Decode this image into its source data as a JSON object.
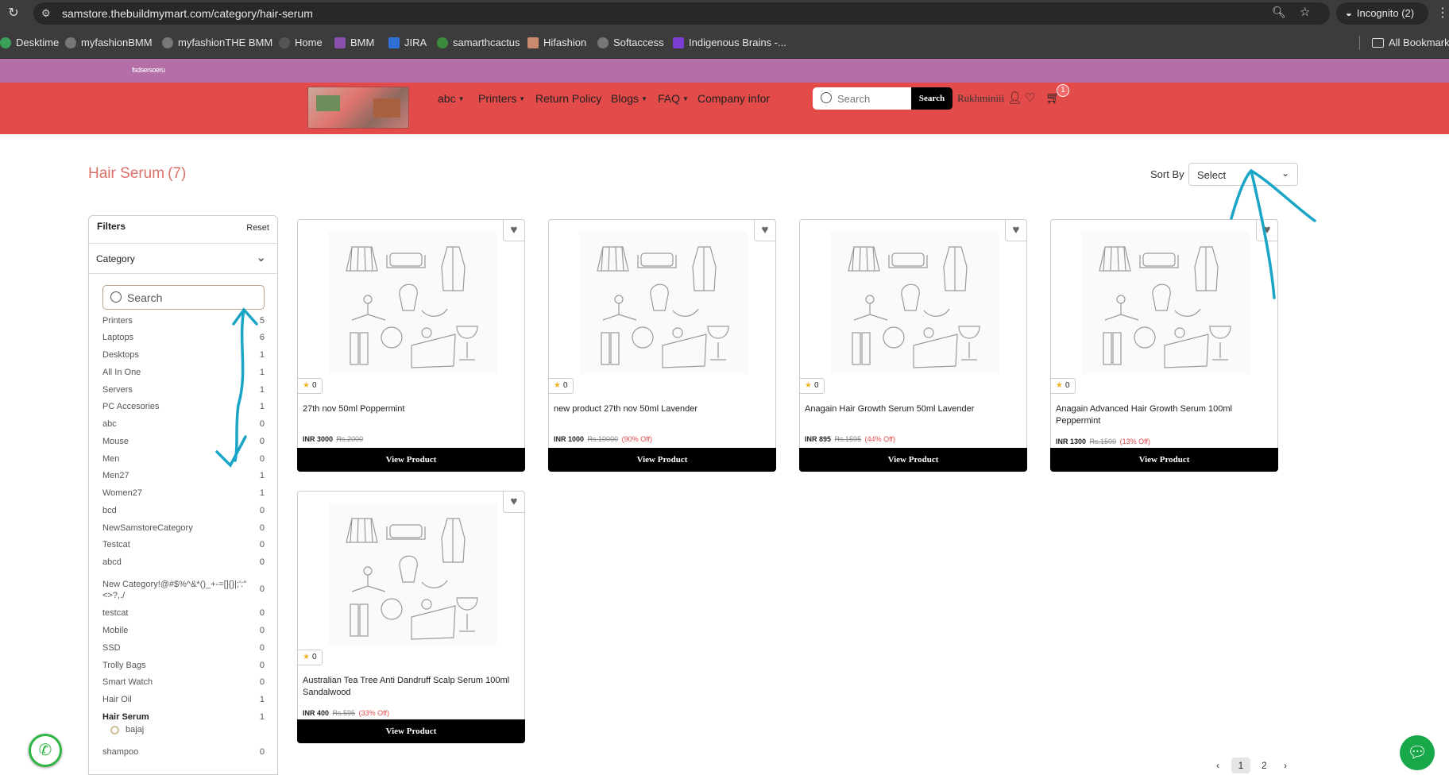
{
  "browser": {
    "url": "samstore.thebuildmymart.com/category/hair-serum",
    "incognito_label": "Incognito (2)",
    "bookmarks": [
      "Desktime",
      "myfashionBMM",
      "myfashionTHE BMM",
      "Home",
      "BMM",
      "JIRA",
      "samarthcactus",
      "Hifashion",
      "Softaccess",
      "Indigenous Brains -...",
      "All Bookmarks"
    ]
  },
  "announcement": {
    "text": "fsdsersoeru"
  },
  "header": {
    "nav": [
      "abc",
      "Printers",
      "Return Policy",
      "Blogs",
      "FAQ",
      "Company infor"
    ],
    "nav_has_caret": [
      true,
      true,
      false,
      true,
      true,
      false
    ],
    "search_placeholder": "Search",
    "search_button": "Search",
    "user_name": "Rukhminiii",
    "cart_count": "1"
  },
  "page": {
    "title": "Hair Serum",
    "count": "(7)",
    "sort_label": "Sort By",
    "sort_value": "Select"
  },
  "filters": {
    "title": "Filters",
    "reset": "Reset",
    "category_title": "Category",
    "search_placeholder": "Search",
    "categories": [
      {
        "name": "Printers",
        "count": "5"
      },
      {
        "name": "Laptops",
        "count": "6"
      },
      {
        "name": "Desktops",
        "count": "1"
      },
      {
        "name": "All In One",
        "count": "1"
      },
      {
        "name": "Servers",
        "count": "1"
      },
      {
        "name": "PC Accesories",
        "count": "1"
      },
      {
        "name": "abc",
        "count": "0"
      },
      {
        "name": "Mouse",
        "count": "0"
      },
      {
        "name": "Men",
        "count": "0"
      },
      {
        "name": "Men27",
        "count": "1"
      },
      {
        "name": "Women27",
        "count": "1"
      },
      {
        "name": "bcd",
        "count": "0"
      },
      {
        "name": "NewSamstoreCategory",
        "count": "0"
      },
      {
        "name": "Testcat",
        "count": "0"
      },
      {
        "name": "abcd",
        "count": "0"
      },
      {
        "name": "New Category!@#$%^&*()_+-=[]{}|;':\"<>?,./",
        "count": "0"
      },
      {
        "name": "testcat",
        "count": "0"
      },
      {
        "name": "Mobile",
        "count": "0"
      },
      {
        "name": "SSD",
        "count": "0"
      },
      {
        "name": "Trolly Bags",
        "count": "0"
      },
      {
        "name": "Smart Watch",
        "count": "0"
      },
      {
        "name": "Hair Oil",
        "count": "1"
      },
      {
        "name": "Hair Serum",
        "count": "1"
      },
      {
        "name": "shampoo",
        "count": "0"
      }
    ],
    "brand_option": "bajaj"
  },
  "products": [
    {
      "rating": "0",
      "name": "27th nov 50ml Poppermint",
      "price": "INR 3000",
      "mrp": "Rs.2000",
      "off": "",
      "button": "View Product"
    },
    {
      "rating": "0",
      "name": "new product 27th nov 50ml Lavender",
      "price": "INR 1000",
      "mrp": "Rs.10000",
      "off": "(90% Off)",
      "button": "View Product"
    },
    {
      "rating": "0",
      "name": "Anagain Hair Growth Serum 50ml Lavender",
      "price": "INR 895",
      "mrp": "Rs.1595",
      "off": "(44% Off)",
      "button": "View Product"
    },
    {
      "rating": "0",
      "name": "Anagain Advanced Hair Growth Serum 100ml Peppermint",
      "price": "INR 1300",
      "mrp": "Rs.1500",
      "off": "(13% Off)",
      "button": "View Product"
    },
    {
      "rating": "0",
      "name": "Australian Tea Tree Anti Dandruff Scalp Serum 100ml Sandalwood",
      "price": "INR 400",
      "mrp": "Rs.595",
      "off": "(33% Off)",
      "button": "View Product"
    }
  ],
  "pagination": {
    "prev": "‹",
    "pages": [
      "1",
      "2"
    ],
    "next": "›",
    "active": "1"
  },
  "colors": {
    "header": "#e24b4a",
    "announcement": "#b46fa9",
    "title": "#d9716a",
    "annotation": "#1aa5c6"
  },
  "icons": [
    "reload-icon",
    "site-info-icon",
    "zoom-icon",
    "star-icon",
    "incognito-icon",
    "user-icon",
    "heart-icon",
    "cart-icon",
    "whatsapp-icon",
    "chat-icon"
  ]
}
